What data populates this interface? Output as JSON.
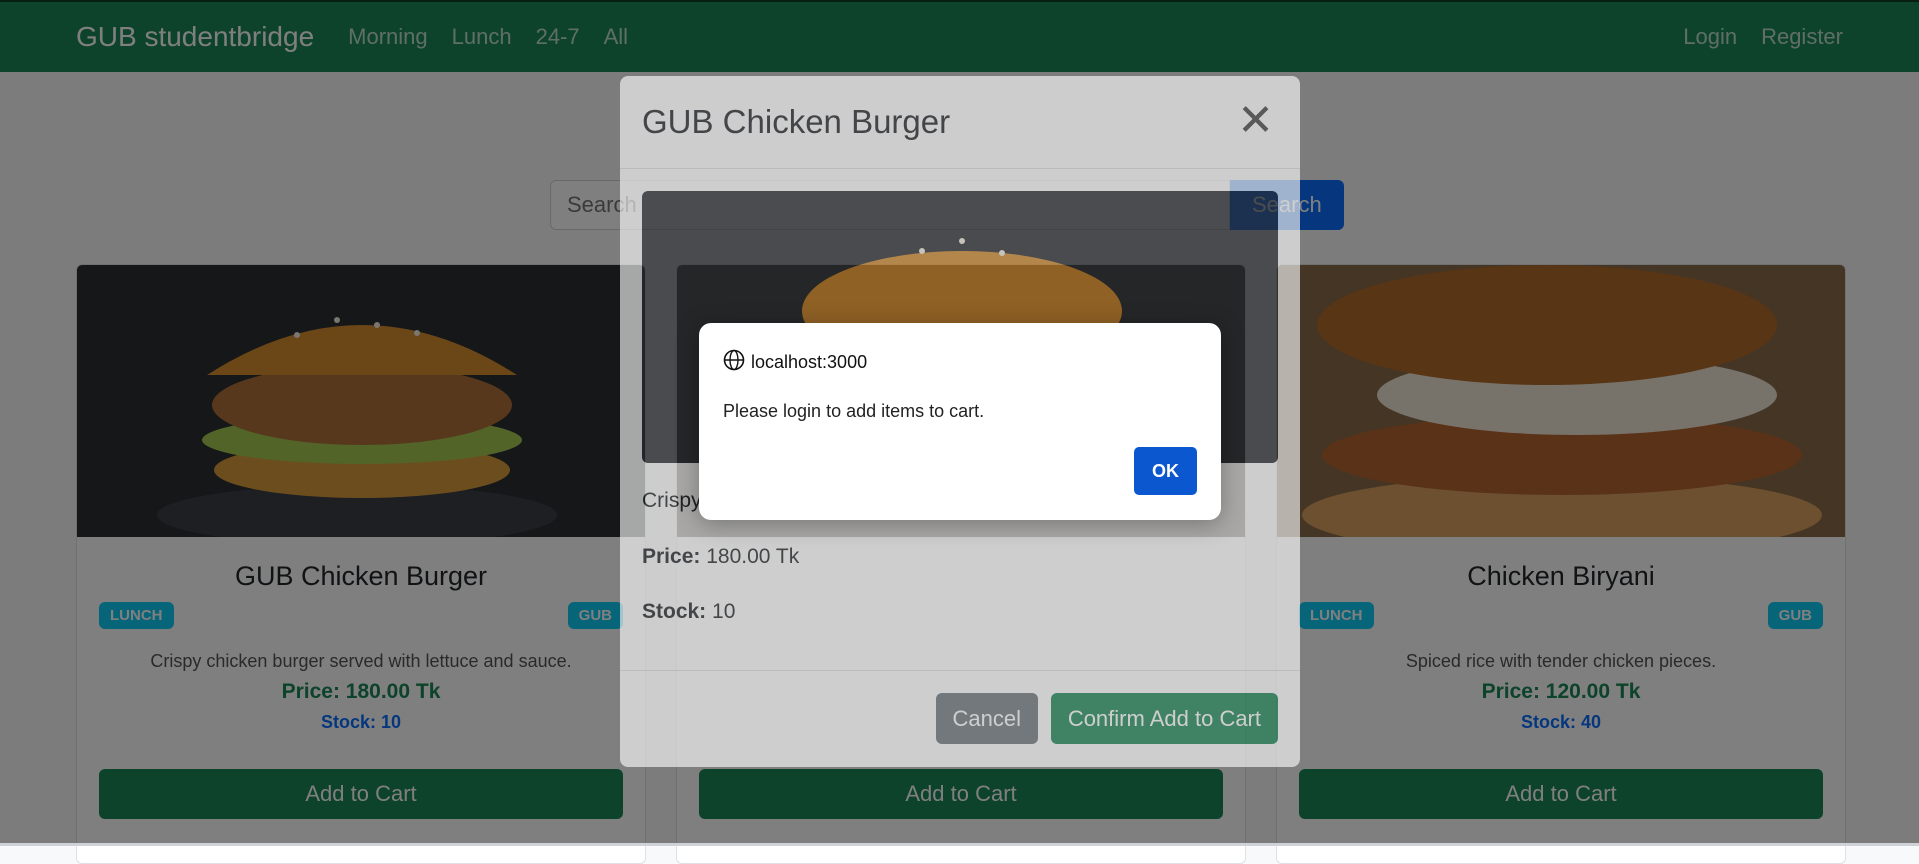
{
  "navbar": {
    "brand": "GUB studentbridge",
    "links": [
      "Morning",
      "Lunch",
      "24-7",
      "All"
    ],
    "right_links": [
      "Login",
      "Register"
    ]
  },
  "search": {
    "placeholder": "Search",
    "button_label": "Search"
  },
  "cards": [
    {
      "title": "GUB Chicken Burger",
      "category_badge": "LUNCH",
      "vendor_badge": "GUB",
      "description": "Crispy chicken burger served with lettuce and sauce.",
      "price": "Price: 180.00 Tk",
      "stock": "Stock: 10",
      "button": "Add to Cart"
    },
    {
      "button": "Add to Cart"
    },
    {
      "title": "Chicken Biryani",
      "category_badge": "LUNCH",
      "vendor_badge": "GUB",
      "description": "Spiced rice with tender chicken pieces.",
      "price": "Price: 120.00 Tk",
      "stock": "Stock: 40",
      "button": "Add to Cart"
    }
  ],
  "modal": {
    "title": "GUB Chicken Burger",
    "close_symbol": "✕",
    "description": "Crispy",
    "price_label": "Price:",
    "price_value": " 180.00 Tk",
    "stock_label": "Stock:",
    "stock_value": " 10",
    "cancel_label": "Cancel",
    "confirm_label": "Confirm Add to Cart"
  },
  "alert": {
    "origin": "localhost:3000",
    "message": "Please login to add items to cart.",
    "ok_label": "OK"
  },
  "colors": {
    "primary_green": "#198754",
    "primary_blue": "#0d6efd",
    "badge_info": "#0dcaf0",
    "alert_ok": "#0b57d0"
  }
}
